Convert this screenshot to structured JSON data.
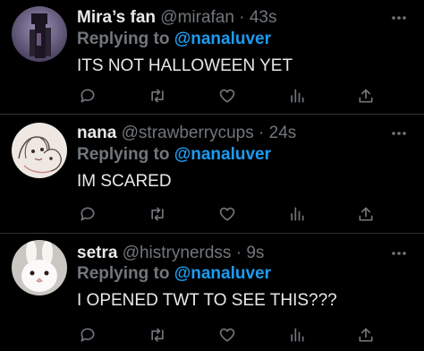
{
  "replies": [
    {
      "name": "Mira’s fan",
      "handle": "@mirafan",
      "separator": "·",
      "time": "43s",
      "replying_prefix": "Replying to",
      "replying_to": "@nanaluver",
      "text": "ITS NOT HALLOWEEN YET",
      "avatar_icon": "avatar-dark-figure"
    },
    {
      "name": "nana",
      "handle": "@strawberrycups",
      "separator": "·",
      "time": "24s",
      "replying_prefix": "Replying to",
      "replying_to": "@nanaluver",
      "text": "IM SCARED",
      "avatar_icon": "avatar-sketch-drawing"
    },
    {
      "name": "setra",
      "handle": "@histrynerdss",
      "separator": "·",
      "time": "9s",
      "replying_prefix": "Replying to",
      "replying_to": "@nanaluver",
      "text": "I OPENED TWT TO SEE THIS???",
      "avatar_icon": "avatar-white-bunny"
    }
  ],
  "action_icons": [
    "reply-icon",
    "retweet-icon",
    "like-icon",
    "views-icon",
    "share-icon"
  ],
  "colors": {
    "background": "#000000",
    "primary_text": "#e7e9ea",
    "secondary_text": "#71767b",
    "mention": "#1d9bf0",
    "divider": "#2f3336"
  }
}
